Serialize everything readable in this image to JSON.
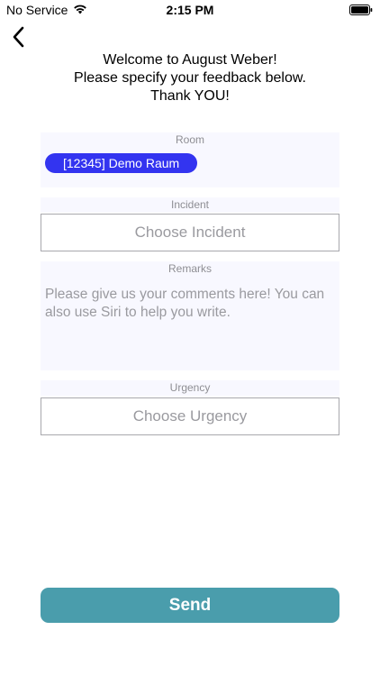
{
  "status_bar": {
    "carrier": "No Service",
    "time": "2:15 PM"
  },
  "header": {
    "back_icon": "chevron-left-icon",
    "welcome_line1": "Welcome to August Weber!",
    "welcome_line2": "Please specify your feedback below.",
    "welcome_line3": "Thank YOU!"
  },
  "room": {
    "label": "Room",
    "selected": "[12345] Demo Raum"
  },
  "incident": {
    "label": "Incident",
    "placeholder": "Choose Incident"
  },
  "remarks": {
    "label": "Remarks",
    "placeholder": "Please give us your comments here! You can also use Siri to help you write."
  },
  "urgency": {
    "label": "Urgency",
    "placeholder": "Choose Urgency"
  },
  "send": {
    "label": "Send"
  },
  "colors": {
    "accent_chip": "#3334f0",
    "send_button": "#4a9dac",
    "panel_bg": "#f8f8ff"
  }
}
